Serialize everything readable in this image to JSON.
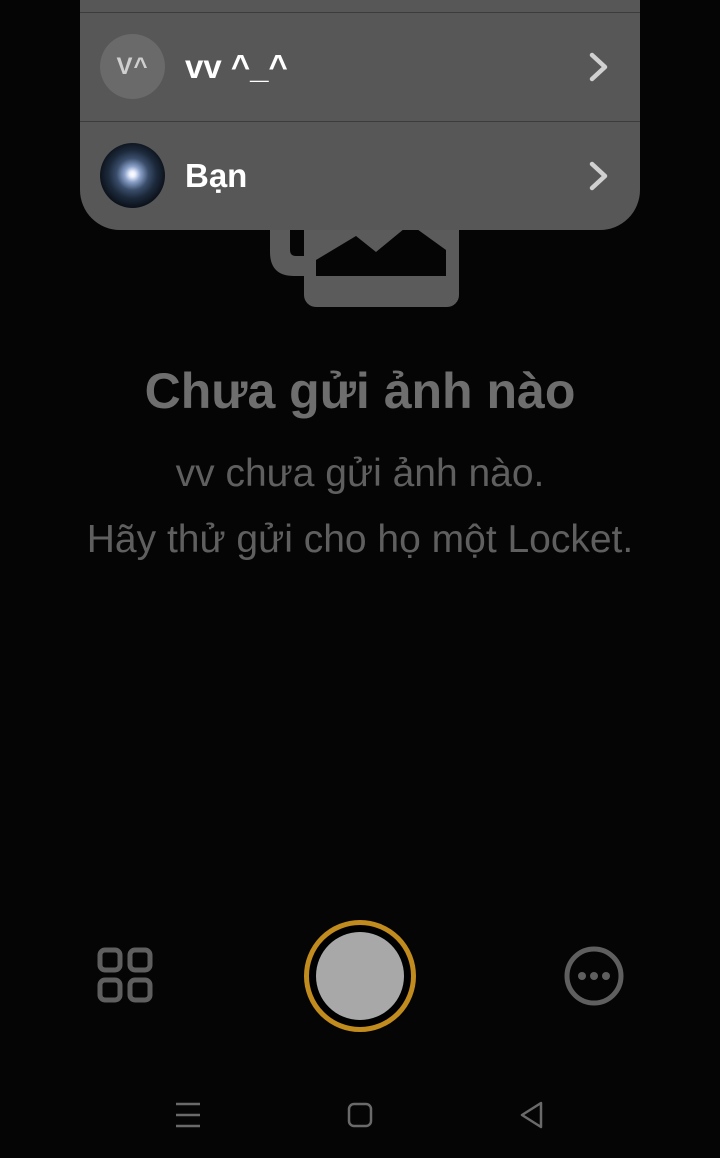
{
  "empty_state": {
    "illustration_icon": "photo-stack-icon",
    "title": "Chưa gửi ảnh nào",
    "subtitle_line1": "vv chưa gửi ảnh nào.",
    "subtitle_line2": "Hãy thử gửi cho họ một Locket."
  },
  "friends_dropdown": {
    "items": [
      {
        "avatar_text": "V^",
        "name": "vv ^_^",
        "chevron_icon": "chevron-right-icon"
      },
      {
        "avatar_type": "photo",
        "name": "Bạn",
        "chevron_icon": "chevron-right-icon"
      }
    ]
  },
  "bottom_bar": {
    "grid_icon": "grid-view-icon",
    "shutter_icon": "shutter-icon",
    "more_icon": "more-options-icon"
  },
  "nav_bar": {
    "menu_icon": "menu-icon",
    "home_icon": "home-icon",
    "back_icon": "back-icon"
  },
  "colors": {
    "background": "#050505",
    "dropdown": "#575757",
    "muted_text": "#6e6e6e",
    "shutter_ring": "#c18b1e",
    "shutter_fill": "#a8a8a8",
    "icon_gray": "#5f5f5f"
  }
}
